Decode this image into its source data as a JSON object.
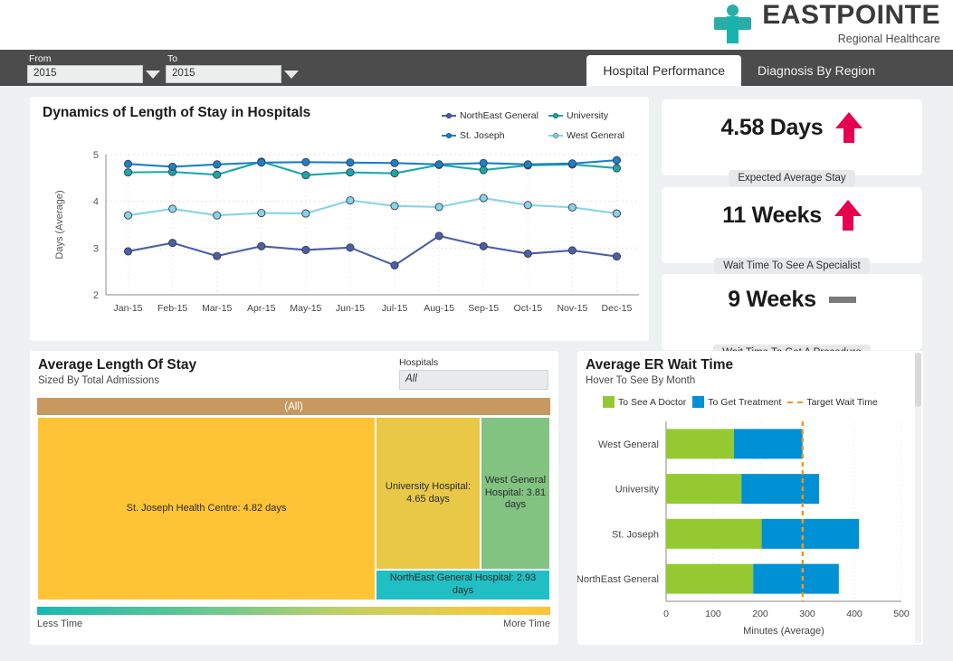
{
  "brand": {
    "name": "EASTPOINTE",
    "tagline": "Regional Healthcare",
    "logo_icon": "medical-cross-person-icon",
    "color": "#2aada6"
  },
  "topbar": {
    "from_label": "From",
    "from_value": "2015",
    "to_label": "To",
    "to_value": "2015",
    "caret_icon": "chevron-down-icon",
    "tabs": [
      {
        "label": "Hospital Performance",
        "active": true
      },
      {
        "label": "Diagnosis By Region",
        "active": false
      }
    ]
  },
  "line_panel": {
    "title": "Dynamics of Length of Stay in Hospitals"
  },
  "kpis": [
    {
      "value": "4.58 Days",
      "caption": "Expected Average Stay",
      "indicator": "up-arrow-icon",
      "color": "#e6004e"
    },
    {
      "value": "11 Weeks",
      "caption": "Wait Time To See A Specialist",
      "indicator": "up-arrow-icon",
      "color": "#e6004e"
    },
    {
      "value": "9 Weeks",
      "caption": "Wait Time To Get A Procedure",
      "indicator": "flat-dash-icon",
      "color": "#7a7a7a"
    }
  ],
  "treemap_panel": {
    "title": "Average Length Of Stay",
    "subtitle": "Sized By Total Admissions",
    "filter_label": "Hospitals",
    "filter_value": "All",
    "header_label": "(All)",
    "legend_low": "Less Time",
    "legend_high": "More Time"
  },
  "er_panel": {
    "title": "Average ER Wait Time",
    "subtitle": "Hover To See By Month"
  },
  "chart_data": [
    {
      "type": "line",
      "title": "Dynamics of Length of Stay in Hospitals",
      "xlabel": "",
      "ylabel": "Days (Average)",
      "ylim": [
        2,
        5
      ],
      "yticks": [
        2,
        3,
        4,
        5
      ],
      "grid": true,
      "legend_position": "top-right",
      "categories": [
        "Jan-15",
        "Feb-15",
        "Mar-15",
        "Apr-15",
        "May-15",
        "Jun-15",
        "Jul-15",
        "Aug-15",
        "Sep-15",
        "Oct-15",
        "Nov-15",
        "Dec-15"
      ],
      "series": [
        {
          "name": "NorthEast General",
          "color": "#4a5fa5",
          "values": [
            2.93,
            3.11,
            2.83,
            3.04,
            2.96,
            3.01,
            2.63,
            3.26,
            3.04,
            2.88,
            2.95,
            2.82
          ]
        },
        {
          "name": "University",
          "color": "#17a9a9",
          "values": [
            4.62,
            4.63,
            4.57,
            4.85,
            4.56,
            4.62,
            4.6,
            4.78,
            4.67,
            4.77,
            4.79,
            4.71
          ]
        },
        {
          "name": "St. Joseph",
          "color": "#1b80c8",
          "values": [
            4.8,
            4.74,
            4.79,
            4.83,
            4.84,
            4.83,
            4.82,
            4.79,
            4.82,
            4.79,
            4.81,
            4.88
          ]
        },
        {
          "name": "West General",
          "color": "#87d3e8",
          "values": [
            3.7,
            3.84,
            3.7,
            3.75,
            3.74,
            4.02,
            3.9,
            3.88,
            4.07,
            3.92,
            3.87,
            3.74
          ]
        }
      ]
    },
    {
      "type": "bar",
      "orientation": "horizontal",
      "stacked": true,
      "title": "Average ER Wait Time",
      "xlabel": "Minutes (Average)",
      "ylabel": "",
      "xlim": [
        0,
        500
      ],
      "xticks": [
        0,
        100,
        200,
        300,
        400,
        500
      ],
      "grid": true,
      "categories": [
        "West General",
        "University",
        "St. Joseph",
        "NorthEast General"
      ],
      "series": [
        {
          "name": "To See A Doctor",
          "color": "#95c932",
          "values": [
            144,
            160,
            203,
            185
          ]
        },
        {
          "name": "To Get Treatment",
          "color": "#0090d4",
          "values": [
            146,
            165,
            207,
            182
          ]
        }
      ],
      "annotations": [
        {
          "name": "Target Wait Time",
          "type": "vline",
          "value": 290,
          "color": "#f5941f",
          "style": "dashed"
        }
      ]
    },
    {
      "type": "treemap",
      "title": "Average Length Of Stay",
      "subtitle": "Sized By Total Admissions",
      "root_label": "(All)",
      "nodes": [
        {
          "label": "St. Joseph Health Centre: 4.82 days",
          "days": 4.82,
          "color": "#ffc436"
        },
        {
          "label": "University Hospital: 4.65 days",
          "days": 4.65,
          "color": "#e8c846"
        },
        {
          "label": "West General Hospital: 3.81 days",
          "days": 3.81,
          "color": "#82c382"
        },
        {
          "label": "NorthEast General Hospital: 2.93 days",
          "days": 2.93,
          "color": "#1fbfc3"
        }
      ],
      "color_legend": {
        "low": "Less Time",
        "high": "More Time"
      }
    }
  ]
}
